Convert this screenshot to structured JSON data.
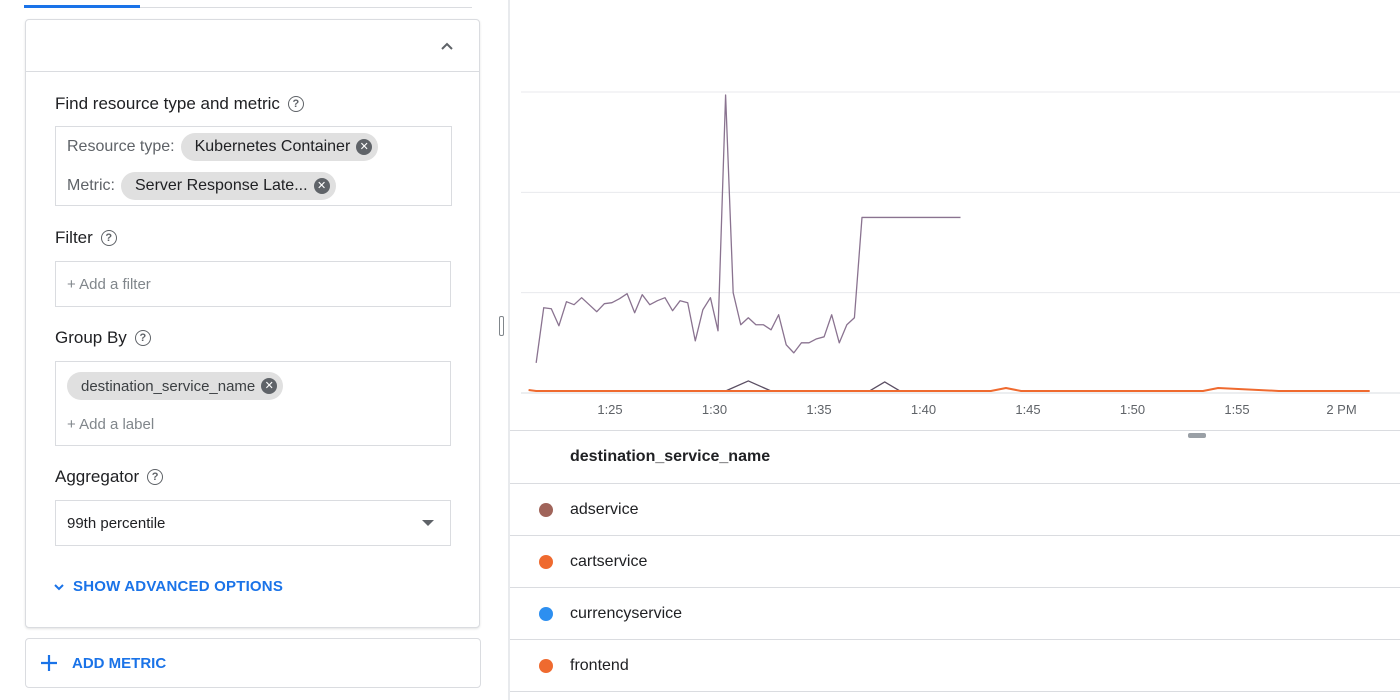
{
  "colors": {
    "accent": "#1a73e8",
    "adservice": "#a0645a",
    "cartservice": "#ef6a2f",
    "currencyservice": "#2d8ff0",
    "frontend": "#ef6a2f",
    "series_line": "#8a7390"
  },
  "query": {
    "find_label": "Find resource type and metric",
    "resource_type_label": "Resource type:",
    "resource_type_value": "Kubernetes Container",
    "metric_label": "Metric:",
    "metric_value": "Server Response Late...",
    "filter_label": "Filter",
    "filter_placeholder": "+ Add a filter",
    "group_by_label": "Group By",
    "group_by_chip": "destination_service_name",
    "group_by_placeholder": "+ Add a label",
    "aggregator_label": "Aggregator",
    "aggregator_value": "99th percentile",
    "advanced_options": "SHOW ADVANCED OPTIONS",
    "add_metric": "ADD METRIC"
  },
  "chart_data": {
    "type": "line",
    "x_ticks": [
      "1:25",
      "1:30",
      "1:35",
      "1:40",
      "1:45",
      "1:50",
      "1:55",
      "2 PM"
    ],
    "grid": true,
    "series": [
      {
        "color": "#8a7390",
        "x": [
          1.0,
          1.5,
          2.0,
          2.5,
          3.0,
          3.5,
          4.0,
          4.5,
          5.0,
          5.5,
          6.0,
          6.5,
          7.0,
          7.5,
          8.0,
          8.5,
          9.0,
          9.5,
          10.0,
          10.5,
          11.0,
          11.5,
          12.0,
          12.5,
          13.0,
          13.5,
          14.0,
          14.5,
          15.0,
          15.5,
          16.0,
          16.5,
          17.0,
          17.5,
          18.0,
          18.5,
          19.0,
          19.5,
          20.0,
          20.5,
          21.0,
          21.5,
          22.0,
          22.5,
          23.0,
          23.5,
          24.0,
          24.5,
          25.0,
          25.5,
          26.0,
          26.5,
          27.0,
          27.5,
          28.0,
          28.5,
          29.0
        ],
        "y": [
          0.3,
          0.85,
          0.84,
          0.67,
          0.91,
          0.88,
          0.95,
          0.88,
          0.81,
          0.89,
          0.9,
          0.94,
          0.99,
          0.8,
          0.98,
          0.88,
          0.92,
          0.95,
          0.82,
          0.92,
          0.9,
          0.52,
          0.83,
          0.95,
          0.62,
          2.97,
          1.0,
          0.68,
          0.75,
          0.68,
          0.68,
          0.63,
          0.78,
          0.48,
          0.4,
          0.5,
          0.5,
          0.54,
          0.56,
          0.78,
          0.5,
          0.68,
          0.75,
          1.75,
          1.75,
          1.75,
          1.75,
          1.75,
          1.75,
          1.75,
          1.75,
          1.75,
          1.75,
          1.75,
          1.75,
          1.75,
          1.75
        ]
      },
      {
        "color": "#5a4e63",
        "x": [
          13.5,
          15.0,
          16.5,
          23.0,
          24.0,
          25.0
        ],
        "y": [
          0.02,
          0.12,
          0.02,
          0.02,
          0.11,
          0.02
        ]
      },
      {
        "color": "#ef6a2f",
        "x": [
          0.5,
          1.0,
          5.0,
          11.0,
          21.0,
          30.0,
          31.0,
          32.0,
          33.0,
          34.0,
          35.0,
          45.0,
          46.0,
          50.0,
          56.0
        ],
        "y": [
          0.03,
          0.02,
          0.02,
          0.02,
          0.02,
          0.02,
          0.02,
          0.05,
          0.02,
          0.02,
          0.02,
          0.02,
          0.05,
          0.02,
          0.02
        ]
      }
    ]
  },
  "legend": {
    "header": "destination_service_name",
    "rows": [
      {
        "name": "adservice",
        "color": "#a0645a"
      },
      {
        "name": "cartservice",
        "color": "#ef6a2f"
      },
      {
        "name": "currencyservice",
        "color": "#2d8ff0"
      },
      {
        "name": "frontend",
        "color": "#ef6a2f"
      }
    ]
  }
}
